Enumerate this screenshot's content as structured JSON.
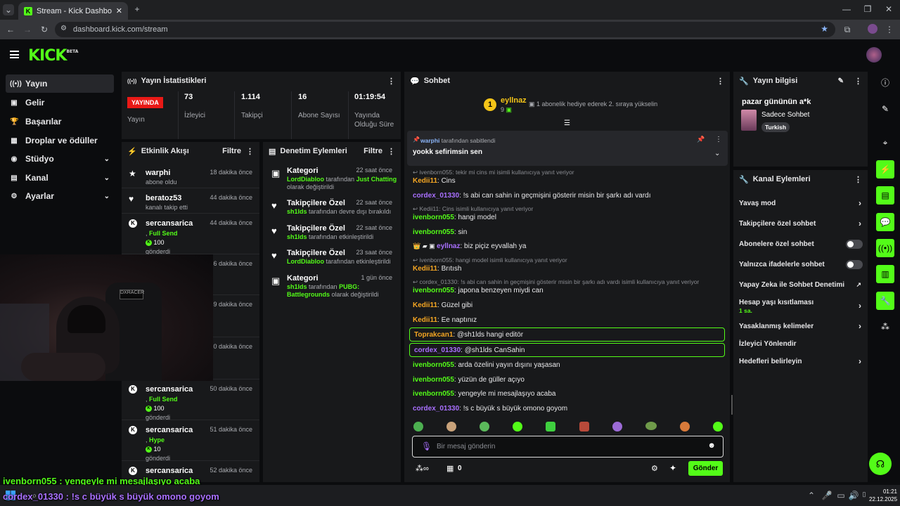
{
  "browser": {
    "tab_title": "Stream - Kick Dashboard",
    "url": "dashboard.kick.com/stream"
  },
  "app": {
    "logo": "KICK",
    "logo_badge": "BETA"
  },
  "sidebar": {
    "items": [
      {
        "label": "Yayın",
        "icon": "broadcast-icon"
      },
      {
        "label": "Gelir",
        "icon": "money-icon"
      },
      {
        "label": "Başarılar",
        "icon": "trophy-icon"
      },
      {
        "label": "Droplar ve ödüller",
        "icon": "gift-icon"
      },
      {
        "label": "Stüdyo",
        "icon": "studio-icon"
      },
      {
        "label": "Kanal",
        "icon": "channel-icon"
      },
      {
        "label": "Ayarlar",
        "icon": "gear-icon"
      }
    ]
  },
  "stats": {
    "title": "Yayın İstatistikleri",
    "live_badge": "YAYINDA",
    "live_label": "Yayın",
    "viewers_value": "73",
    "viewers_label": "İzleyici",
    "followers_value": "1.114",
    "followers_label": "Takipçi",
    "subs_value": "16",
    "subs_label": "Abone Sayısı",
    "duration_value": "01:19:54",
    "duration_label": "Yayında Olduğu Süre"
  },
  "activity": {
    "title": "Etkinlik Akışı",
    "filter": "Filtre",
    "items": [
      {
        "name": "warphi",
        "time": "18 dakika önce",
        "sub": "abone oldu"
      },
      {
        "name": "beratoz53",
        "time": "44 dakika önce",
        "sub": "kanalı takip etti"
      },
      {
        "name": "sercansarica",
        "time": "44 dakika önce",
        "tier": "Full Send",
        "amount": "100",
        "sub": "gönderdi"
      },
      {
        "time": "46 dakika önce"
      },
      {
        "time": "49 dakika önce"
      },
      {
        "time": "50 dakika önce"
      },
      {
        "name": "sercansarica",
        "time": "50 dakika önce",
        "tier": "Full Send",
        "amount": "100",
        "sub": "gönderdi"
      },
      {
        "name": "sercansarica",
        "time": "51 dakika önce",
        "tier": "Hype",
        "amount": "10",
        "sub": "gönderdi"
      },
      {
        "name": "sercansarica",
        "time": "52 dakika önce"
      }
    ]
  },
  "moderation": {
    "title": "Denetim Eylemleri",
    "filter": "Filtre",
    "items": [
      {
        "title": "Kategori",
        "time": "22 saat önce",
        "user": "LordDiabloo",
        "mid": "tarafından",
        "extra": "Just Chatting",
        "tail": "olarak değiştirildi"
      },
      {
        "title": "Takipçilere Özel",
        "time": "22 saat önce",
        "user": "sh1lds",
        "mid": "tarafından devre dışı bırakıldı"
      },
      {
        "title": "Takipçilere Özel",
        "time": "22 saat önce",
        "user": "sh1lds",
        "mid": "tarafından etkinleştirildi"
      },
      {
        "title": "Takipçilere Özel",
        "time": "23 saat önce",
        "user": "LordDiabloo",
        "mid": "tarafından etkinleştirildi"
      },
      {
        "title": "Kategori",
        "time": "1 gün önce",
        "user": "sh1lds",
        "mid": "tarafından",
        "extra": "PUBG: Battlegrounds",
        "tail": "olarak değiştirildi"
      }
    ]
  },
  "chat": {
    "title": "Sohbet",
    "top_gifter": "eyllnaz",
    "top_gifter_count": "9",
    "rank": "1",
    "gift_text": "1 abonelik hediye ederek 2. sıraya yükselin",
    "pinned_by_user": "warphi",
    "pinned_by_text": "tarafından sabitlendi",
    "pinned_message": "yookk sefirimsin sen",
    "messages": [
      {
        "reply": "ivenborn055: tekir mi cins mi isimli kullanıcıya yanıt veriyor"
      },
      {
        "user": "Kedii11",
        "color": "#f5a623",
        "text": ": Cins"
      },
      {
        "user": "cordex_01330",
        "color": "#a970ff",
        "text": ": !s abi can sahin in geçmişini gösterir misin bir şarkı adı vardı"
      },
      {
        "reply": "Kedii11: Cins isimli kullanıcıya yanıt veriyor"
      },
      {
        "user": "ivenborn055",
        "color": "#53fc18",
        "text": ": hangi model"
      },
      {
        "user": "ivenborn055",
        "color": "#53fc18",
        "text": ": sin"
      },
      {
        "user": "eyllnaz",
        "color": "#a970ff",
        "text": ": biz piçiz eyvallah ya"
      },
      {
        "reply": "ivenborn055: hangi model isimli kullanıcıya yanıt veriyor"
      },
      {
        "user": "Kedii11",
        "color": "#f5a623",
        "text": ": Brıtısh"
      },
      {
        "reply": "cordex_01330: !s abi can sahin in geçmişini gösterir misin bir şarkı adı vardı isimli kullanıcıya yanıt veriyor"
      },
      {
        "user": "ivenborn055",
        "color": "#53fc18",
        "text": ": japona benzeyen miydi can"
      },
      {
        "user": "Kedii11",
        "color": "#f5a623",
        "text": ": Güzel gibi"
      },
      {
        "user": "Kedii11",
        "color": "#f5a623",
        "text": ": Ee naptınız"
      },
      {
        "user": "Toprakcan1",
        "color": "#f5a623",
        "text": ": @sh1lds hangi editör"
      },
      {
        "user": "cordex_01330",
        "color": "#a970ff",
        "text": ": @sh1lds CanSahin"
      },
      {
        "user": "ivenborn055",
        "color": "#53fc18",
        "text": ": arda özelini yayın dışını yaşasan"
      },
      {
        "user": "ivenborn055",
        "color": "#53fc18",
        "text": ": yüzün de güller açıyo"
      },
      {
        "user": "ivenborn055",
        "color": "#53fc18",
        "text": ": yengeyle mi mesajlaşıyo acaba"
      },
      {
        "user": "cordex_01330",
        "color": "#a970ff",
        "text": ": !s c büyük s büyük omono goyom"
      }
    ],
    "input_placeholder": "Bir mesaj gönderin",
    "kick_count": "0",
    "send_label": "Gönder"
  },
  "stream_info": {
    "title": "Yayın bilgisi",
    "stream_title": "pazar gününün a*k",
    "category": "Sadece Sohbet",
    "tag": "Turkish"
  },
  "channel_actions": {
    "title": "Kanal Eylemleri",
    "items": [
      {
        "label": "Yavaş mod",
        "type": "arrow"
      },
      {
        "label": "Takipçilere özel sohbet",
        "type": "arrow"
      },
      {
        "label": "Abonelere özel sohbet",
        "type": "toggle"
      },
      {
        "label": "Yalnızca ifadelerle sohbet",
        "type": "toggle"
      },
      {
        "label": "Yapay Zeka ile Sohbet Denetimi",
        "type": "external"
      },
      {
        "label": "Hesap yaşı kısıtlaması",
        "type": "arrow",
        "sub": "1 sa."
      },
      {
        "label": "Yasaklanmış kelimeler",
        "type": "arrow"
      },
      {
        "label": "İzleyici Yönlendir",
        "type": "none"
      },
      {
        "label": "Hedefleri belirleyin",
        "type": "arrow"
      }
    ]
  },
  "overlay": {
    "line1": "ivenborn055 : yengeyle mi mesajlaşıyo acaba",
    "line2": "cordex_01330 : !s c büyük s büyük omono goyom"
  },
  "taskbar": {
    "time": "01:21",
    "date": "22.12.2025"
  },
  "colors": {
    "accent": "#53fc18",
    "live": "#e91916",
    "panel": "#18191b"
  }
}
